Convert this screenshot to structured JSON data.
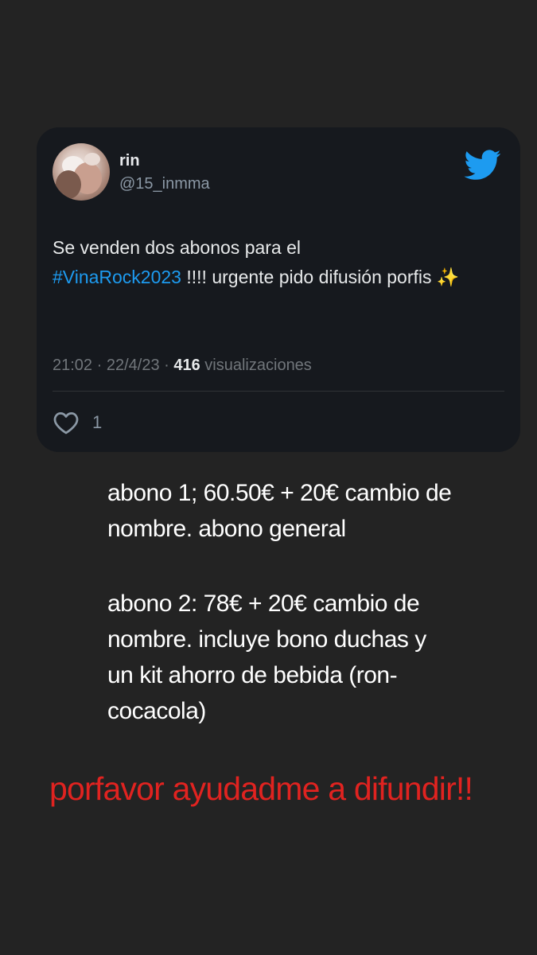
{
  "tweet": {
    "author_name": "rin",
    "author_handle": "@15_inmma",
    "text_before": "Se venden dos abonos para el",
    "hashtag": "#VinaRock2023",
    "text_after": " !!!! urgente pido difusión porfis ✨",
    "time": "21:02",
    "date": "22/4/23",
    "views_count": "416",
    "views_label": "visualizaciones",
    "like_count": "1",
    "icons": {
      "brand": "twitter-bird-icon",
      "like": "heart-icon"
    },
    "colors": {
      "hashtag": "#1d9bf0",
      "brand": "#1d9bf0"
    }
  },
  "story": {
    "abono1": "abono 1; 60.50€ + 20€ cambio de nombre. abono general",
    "abono2": "abono 2: 78€ + 20€ cambio de nombre. incluye bono duchas y un kit ahorro de bebida (ron-cocacola)",
    "cta": "porfavor ayudadme a difundir!!",
    "colors": {
      "cta": "#e02320",
      "background": "#232323"
    }
  }
}
